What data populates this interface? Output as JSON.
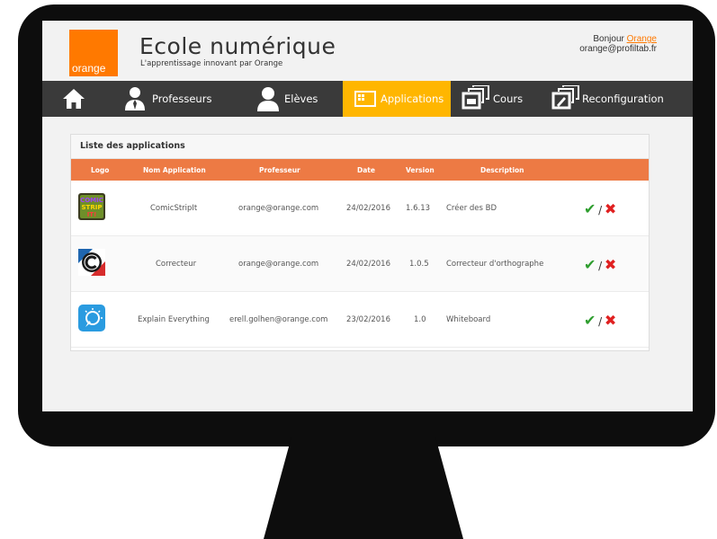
{
  "header": {
    "brand_logo": "orange",
    "title": "Ecole numérique",
    "subtitle": "L'apprentissage innovant par Orange",
    "greeting_prefix": "Bonjour",
    "user_name": "Orange",
    "user_email": "orange@profiltab.fr"
  },
  "nav": {
    "home_icon": "home-icon",
    "items": [
      {
        "label": "Professeurs",
        "icon": "teacher-icon"
      },
      {
        "label": "Elèves",
        "icon": "student-icon"
      },
      {
        "label": "Applications",
        "icon": "applications-icon",
        "active": true
      },
      {
        "label": "Cours",
        "icon": "courses-icon"
      },
      {
        "label": "Reconfiguration",
        "icon": "reconfigure-icon"
      }
    ]
  },
  "panel": {
    "title": "Liste des applications",
    "columns": [
      "Logo",
      "Nom Application",
      "Professeur",
      "Date",
      "Version",
      "Description"
    ],
    "rows": [
      {
        "logo": "comicstripit-logo",
        "logo_text": "COMIC STRIP IT!",
        "name": "ComicStripIt",
        "teacher": "orange@orange.com",
        "date": "24/02/2016",
        "version": "1.6.13",
        "description": "Créer des BD"
      },
      {
        "logo": "correcteur-logo",
        "name": "Correcteur",
        "teacher": "orange@orange.com",
        "date": "24/02/2016",
        "version": "1.0.5",
        "description": "Correcteur d'orthographe"
      },
      {
        "logo": "explain-everything-logo",
        "name": "Explain Everything",
        "teacher": "erell.golhen@orange.com",
        "date": "23/02/2016",
        "version": "1.0",
        "description": "Whiteboard"
      }
    ],
    "action_separator": "/"
  },
  "colors": {
    "brand_orange": "#ff7900",
    "nav_active": "#ffb600",
    "table_header": "#ed7a44",
    "nav_bg": "#3a3a3a",
    "approve": "#2f9e2f",
    "reject": "#e02020"
  }
}
